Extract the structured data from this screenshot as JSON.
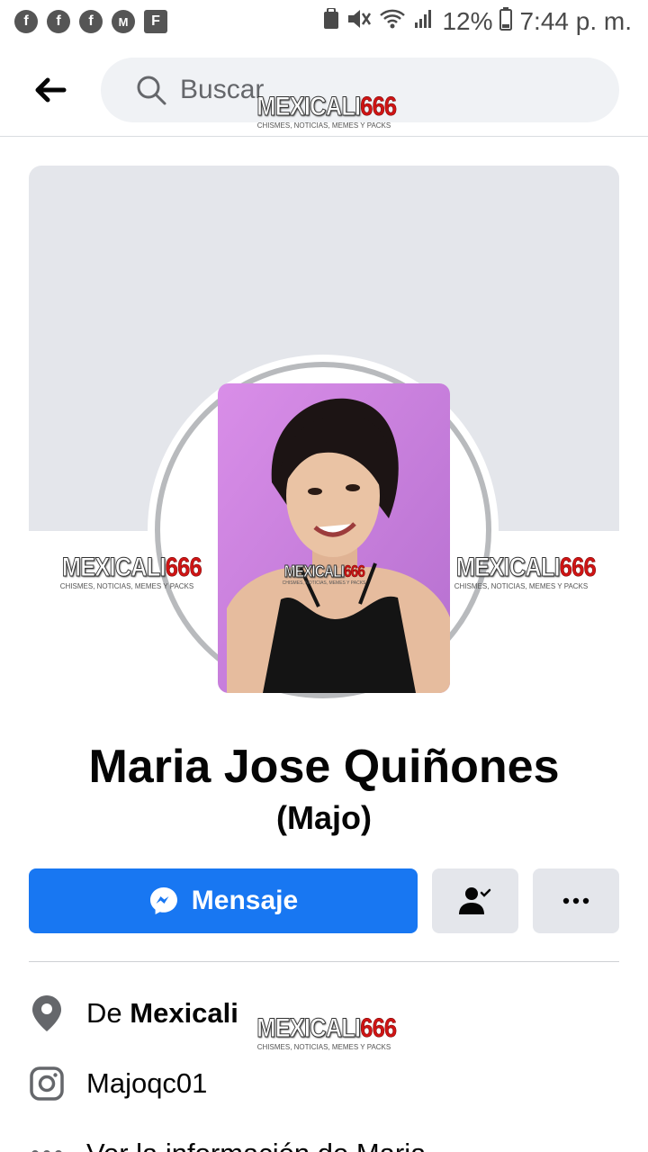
{
  "status_bar": {
    "notification_icons": [
      "facebook-icon",
      "facebook-icon",
      "facebook-icon",
      "messenger-icon",
      "flipboard-icon"
    ],
    "battery": "12%",
    "time": "7:44 p. m."
  },
  "header": {
    "search_placeholder": "Buscar"
  },
  "watermark": {
    "brand_part1": "MEXICALI",
    "brand_part2": "666",
    "tagline": "CHISMES, NOTICIAS, MEMES Y PACKS"
  },
  "profile": {
    "name": "Maria Jose Quiñones",
    "nickname": "(Majo)"
  },
  "actions": {
    "message_label": "Mensaje"
  },
  "details": {
    "hometown_prefix": "De",
    "hometown": "Mexicali",
    "instagram": "Majoqc01",
    "more_info": "Ver la información de Maria"
  },
  "colors": {
    "primary": "#1877f2",
    "button_gray": "#e4e6eb",
    "cover_gray": "#e4e6eb",
    "search_bg": "#f0f2f5"
  }
}
